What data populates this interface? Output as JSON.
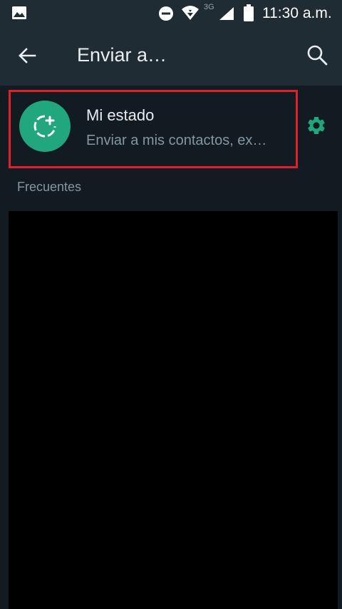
{
  "status_bar": {
    "net_type": "3G",
    "time": "11:30 a.m."
  },
  "app_bar": {
    "title": "Enviar a…"
  },
  "my_status": {
    "name": "Mi estado",
    "subtitle": "Enviar a mis contactos, ex…"
  },
  "sections": {
    "frequent_label": "Frecuentes"
  },
  "colors": {
    "accent": "#21a67d",
    "highlight": "#e2202b",
    "background": "#121b22",
    "toolbar": "#1f2c34"
  },
  "icons": {
    "back": "arrow-left-icon",
    "search": "search-icon",
    "settings": "gear-icon",
    "add_status": "status-add-icon",
    "gallery": "gallery-icon",
    "dnd": "do-not-disturb-icon",
    "wifi": "wifi-icon",
    "signal": "signal-icon",
    "battery": "battery-icon"
  }
}
